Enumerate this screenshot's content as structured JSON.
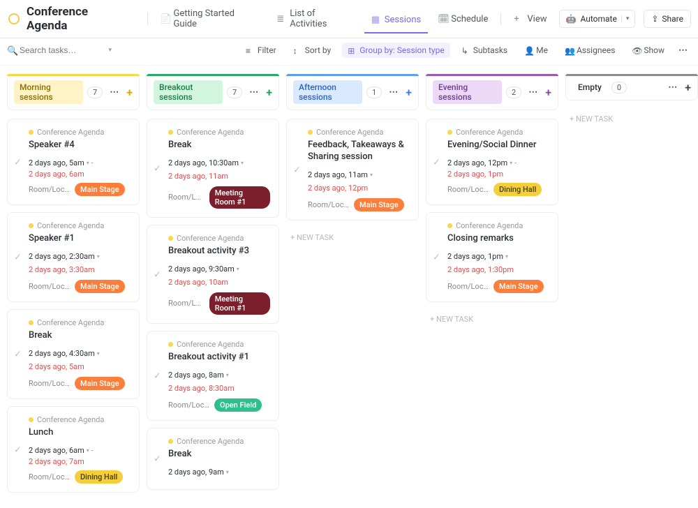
{
  "header": {
    "title": "Conference Agenda",
    "nav": [
      {
        "label": "Getting Started Guide",
        "icon": "doc"
      },
      {
        "label": "List of Activities",
        "icon": "list"
      },
      {
        "label": "Sessions",
        "icon": "board",
        "active": true
      },
      {
        "label": "Schedule",
        "icon": "calendar"
      },
      {
        "label": "View",
        "icon": "plus"
      }
    ],
    "automate": "Automate",
    "share": "Share"
  },
  "toolbar": {
    "search_placeholder": "Search tasks…",
    "filter": "Filter",
    "sort": "Sort by",
    "group": "Group by: Session type",
    "subtasks": "Subtasks",
    "me": "Me",
    "assignees": "Assignees",
    "show": "Show"
  },
  "crumb_text": "Conference Agenda",
  "room_label": "Room/Loca…",
  "new_task_label": "NEW TASK",
  "columns": [
    {
      "id": "morning",
      "label": "Morning sessions",
      "count": 7,
      "badge_cls": "b-yellow",
      "stripe_cls": "c-yellow",
      "plus_cls": "p-yellow",
      "cards": [
        {
          "title": "Speaker #4",
          "start": "2 days ago, 5am",
          "end": "2 days ago, 6am",
          "end_inline": true,
          "loc": "Main Stage",
          "chip": "chip-orange"
        },
        {
          "title": "Speaker #1",
          "start": "2 days ago, 2:30am",
          "end": "2 days ago, 3:30am",
          "end_inline": false,
          "loc": "Main Stage",
          "chip": "chip-orange"
        },
        {
          "title": "Break",
          "start": "2 days ago, 4:30am",
          "end": "2 days ago, 5am",
          "end_inline": false,
          "loc": "Main Stage",
          "chip": "chip-orange"
        },
        {
          "title": "Lunch",
          "start": "2 days ago, 6am",
          "end": "2 days ago, 7am",
          "end_inline": true,
          "loc": "Dining Hall",
          "chip": "chip-yellow"
        }
      ]
    },
    {
      "id": "breakout",
      "label": "Breakout sessions",
      "count": 7,
      "badge_cls": "b-green",
      "stripe_cls": "c-green",
      "plus_cls": "p-green",
      "cards": [
        {
          "title": "Break",
          "start": "2 days ago, 10:30am",
          "end": "2 days ago, 11am",
          "end_inline": false,
          "loc": "Meeting Room #1",
          "chip": "chip-maroon"
        },
        {
          "title": "Breakout activity #3",
          "start": "2 days ago, 9:30am",
          "end": "2 days ago, 10am",
          "end_inline": false,
          "loc": "Meeting Room #1",
          "chip": "chip-maroon"
        },
        {
          "title": "Breakout activity #1",
          "start": "2 days ago, 8am",
          "end": "2 days ago, 8:30am",
          "end_inline": false,
          "loc": "Open Field",
          "chip": "chip-teal"
        },
        {
          "title": "Break",
          "start": "2 days ago, 9am"
        }
      ]
    },
    {
      "id": "afternoon",
      "label": "Afternoon sessions",
      "count": 1,
      "badge_cls": "b-blue",
      "stripe_cls": "c-blue",
      "plus_cls": "p-blue",
      "cards": [
        {
          "title": "Feedback, Takeaways & Sharing session",
          "start": "2 days ago, 11am",
          "end": "2 days ago, 12pm",
          "end_inline": false,
          "loc": "Main Stage",
          "chip": "chip-orange"
        }
      ],
      "show_new_task": true
    },
    {
      "id": "evening",
      "label": "Evening sessions",
      "count": 2,
      "badge_cls": "b-violet",
      "stripe_cls": "c-violet",
      "plus_cls": "p-violet",
      "cards": [
        {
          "title": "Evening/Social Dinner",
          "start": "2 days ago, 12pm",
          "end": "2 days ago, 1pm",
          "end_inline": true,
          "loc": "Dining Hall",
          "chip": "chip-yellow"
        },
        {
          "title": "Closing remarks",
          "start": "2 days ago, 1pm",
          "end": "2 days ago, 1:30pm",
          "end_inline": false,
          "loc": "Main Stage",
          "chip": "chip-orange"
        }
      ],
      "show_new_task": true
    },
    {
      "id": "empty",
      "label": "Empty",
      "count": 0,
      "badge_cls": "b-gray",
      "stripe_cls": "c-gray",
      "plus_cls": "p-gray",
      "cards": [],
      "show_new_task": true
    }
  ]
}
